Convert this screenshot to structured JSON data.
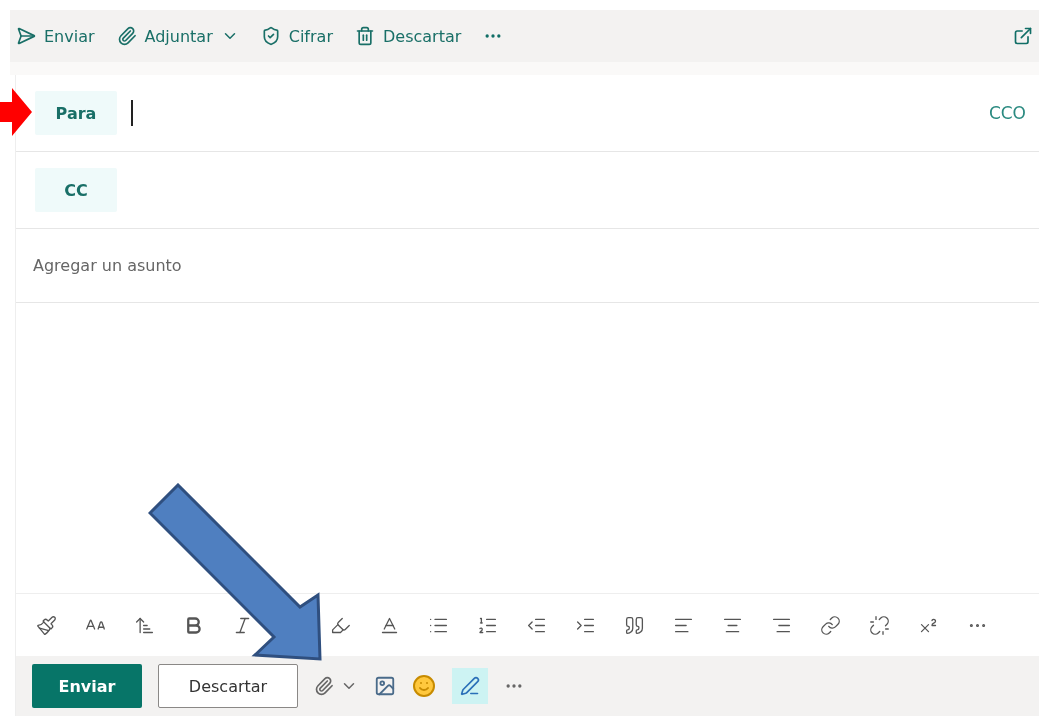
{
  "command_bar": {
    "items": [
      {
        "label": "Enviar",
        "kind": "send"
      },
      {
        "label": "Adjuntar",
        "kind": "attach"
      },
      {
        "label": "Cifrar",
        "kind": "encrypt"
      },
      {
        "label": "Descartar",
        "kind": "discard"
      }
    ]
  },
  "recipients": {
    "to_label": "Para",
    "cc_label": "CC",
    "bcc_link": "CCO"
  },
  "subject": {
    "placeholder": "Agregar un asunto"
  },
  "footer": {
    "send": "Enviar",
    "discard": "Descartar"
  }
}
